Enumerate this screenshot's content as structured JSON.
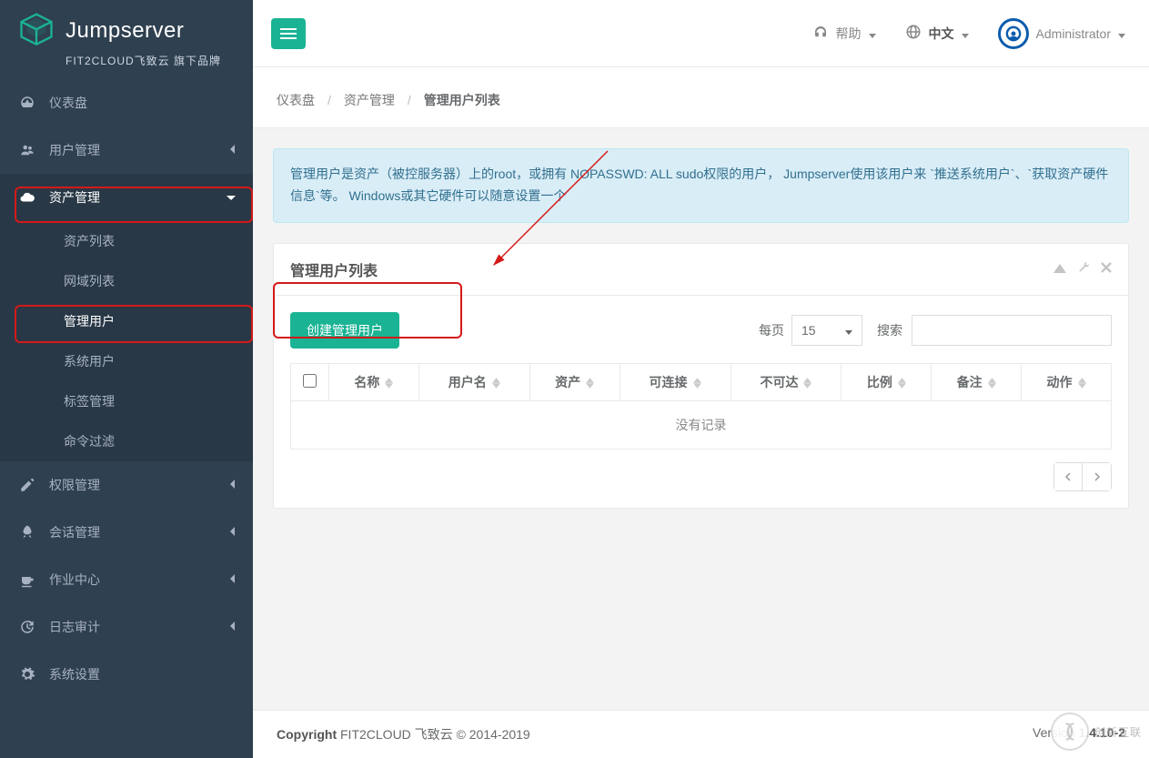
{
  "brand": {
    "name": "Jumpserver",
    "tagline": "FIT2CLOUD飞致云 旗下品牌"
  },
  "topbar": {
    "help": "帮助",
    "language": "中文",
    "user": "Administrator"
  },
  "breadcrumb": {
    "dashboard": "仪表盘",
    "asset_mgmt": "资产管理",
    "current": "管理用户列表"
  },
  "sidebar": {
    "dashboard": "仪表盘",
    "user_mgmt": "用户管理",
    "asset_mgmt": "资产管理",
    "asset_sub": {
      "asset_list": "资产列表",
      "domain_list": "网域列表",
      "admin_user": "管理用户",
      "system_user": "系统用户",
      "label_mgmt": "标签管理",
      "cmd_filter": "命令过滤"
    },
    "perm_mgmt": "权限管理",
    "session_mgmt": "会话管理",
    "job_center": "作业中心",
    "log_audit": "日志审计",
    "sys_settings": "系统设置"
  },
  "info_text": "管理用户是资产（被控服务器）上的root，或拥有 NOPASSWD: ALL sudo权限的用户， Jumpserver使用该用户来 `推送系统用户`、`获取资产硬件信息`等。 Windows或其它硬件可以随意设置一个",
  "panel": {
    "title": "管理用户列表",
    "create_btn": "创建管理用户",
    "per_page_label": "每页",
    "per_page_value": "15",
    "search_label": "搜索",
    "empty": "没有记录"
  },
  "columns": {
    "name": "名称",
    "username": "用户名",
    "assets": "资产",
    "reachable": "可连接",
    "unreachable": "不可达",
    "ratio": "比例",
    "comment": "备注",
    "action": "动作"
  },
  "footer": {
    "copyright_label": "Copyright",
    "copyright_rest": " FIT2CLOUD 飞致云 © 2014-2019",
    "version_label": "Version ",
    "version_value": "1.4.10-2"
  },
  "watermark": "创新互联"
}
